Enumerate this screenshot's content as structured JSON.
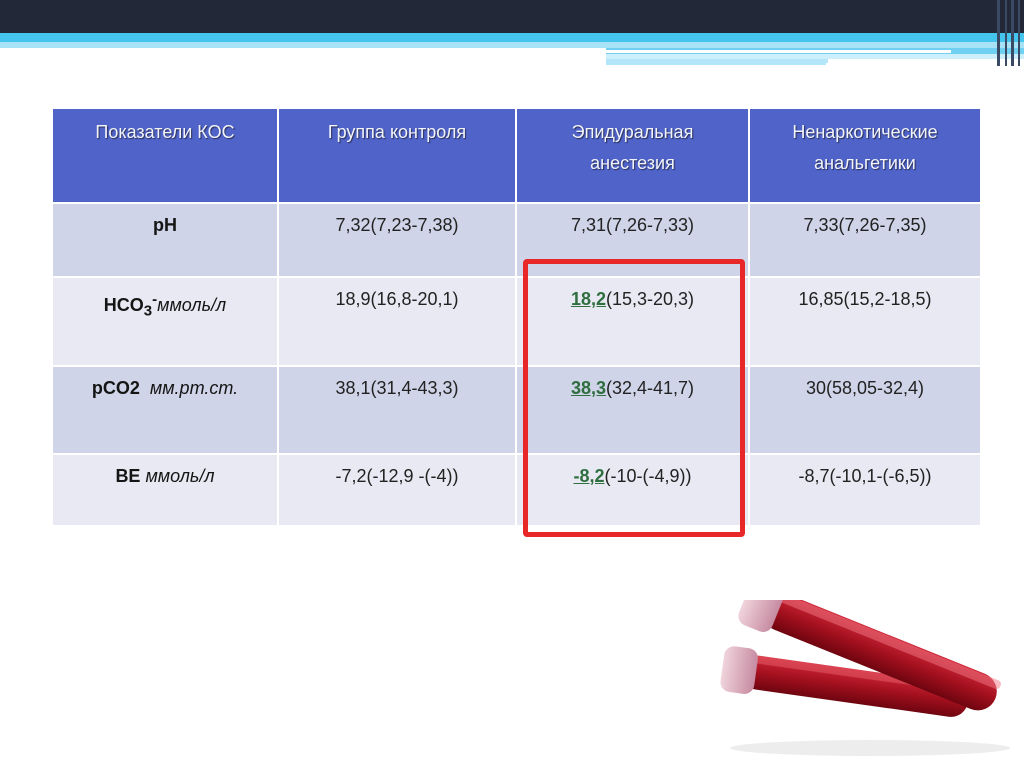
{
  "table": {
    "headers": [
      "Показатели КОС",
      "Группа контроля",
      "Эпидуральная анестезия",
      "Ненаркотические анальгетики"
    ],
    "rows": [
      {
        "label_bold": "pH",
        "label_sub": "",
        "label_sup": "",
        "label_unit": "",
        "control": "7,32(7,23-7,38)",
        "epidural_strong": "",
        "epidural_rest": "7,31(7,26-7,33)",
        "analgesics": "7,33(7,26-7,35)"
      },
      {
        "label_bold": "HCO",
        "label_sub": "3",
        "label_sup": "-",
        "label_unit": "ммоль/л",
        "control": "18,9(16,8-20,1)",
        "epidural_strong": "18,2",
        "epidural_rest": "(15,3-20,3)",
        "analgesics": "16,85(15,2-18,5)"
      },
      {
        "label_bold": "pCO2",
        "label_sub": "",
        "label_sup": "",
        "label_unit": "мм.рт.ст.",
        "control": "38,1(31,4-43,3)",
        "epidural_strong": "38,3",
        "epidural_rest": "(32,4-41,7)",
        "analgesics": "30(58,05-32,4)"
      },
      {
        "label_bold": "BE",
        "label_sub": "",
        "label_sup": "",
        "label_unit": "ммоль/л",
        "control": "-7,2(-12,9 -(-4))",
        "epidural_strong": "-8,2",
        "epidural_rest": "(-10-(-4,9))",
        "analgesics": "-8,7(-10,1-(-6,5))"
      }
    ]
  },
  "colors": {
    "header_bg": "#4f63c9",
    "row_odd": "#d0d4e8",
    "row_even": "#e8e9f2",
    "highlight_border": "#e82828",
    "highlight_value": "#2f6e3f"
  },
  "illustration": {
    "icon": "blood-test-tubes-image"
  }
}
